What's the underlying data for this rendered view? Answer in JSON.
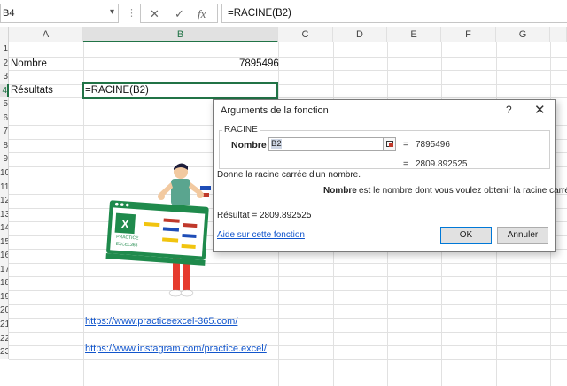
{
  "formula_bar": {
    "name_box": "B4",
    "formula": "=RACINE(B2)"
  },
  "columns": [
    "A",
    "B",
    "C",
    "D",
    "E",
    "F",
    "G"
  ],
  "rows": [
    "1",
    "2",
    "3",
    "4",
    "5",
    "6",
    "7",
    "8",
    "9",
    "10",
    "11",
    "12",
    "13",
    "14",
    "15",
    "16",
    "17",
    "18",
    "19",
    "20",
    "21",
    "22",
    "23"
  ],
  "cells": {
    "a2": "Nombre",
    "b2": "7895496",
    "a4": "Résultats",
    "b4": "=RACINE(B2)"
  },
  "links": {
    "row21": "https://www.practiceexcel-365.com/",
    "row23": "https://www.instagram.com/practice.excel/"
  },
  "logo": {
    "text1": "PRACTICE",
    "text2": "EXCEL365"
  },
  "dialog": {
    "title": "Arguments de la fonction",
    "help": "?",
    "close": "✕",
    "function_name": "RACINE",
    "arg_label": "Nombre",
    "arg_value": "B2",
    "arg_eq": "=",
    "arg_result": "7895496",
    "func_eq": "=",
    "func_result": "2809.892525",
    "description": "Donne la racine carrée d'un nombre.",
    "arg_desc_name": "Nombre",
    "arg_desc": "est le nombre dont vous voulez obtenir la racine carrée.",
    "result_label": "Résultat =",
    "result_value": "2809.892525",
    "help_link": "Aide sur cette fonction",
    "ok": "OK",
    "cancel": "Annuler"
  },
  "colors": {
    "excel_green": "#217346",
    "link_blue": "#1155cc"
  }
}
